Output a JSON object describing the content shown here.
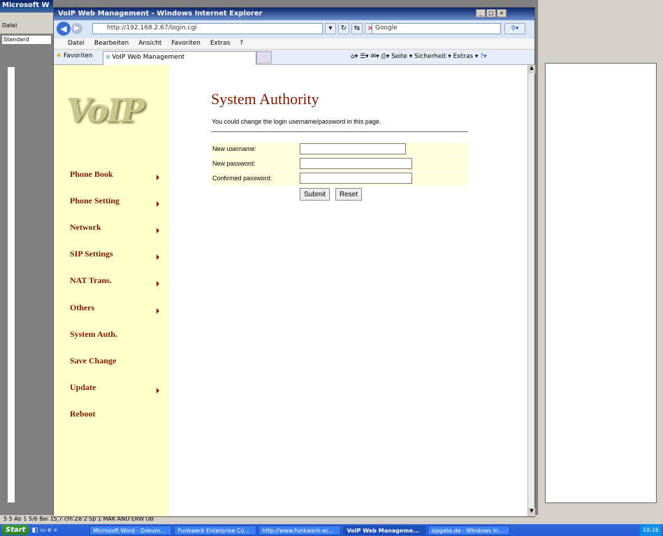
{
  "word": {
    "title": "Microsoft W",
    "style_value": "Standard",
    "menu_file": "Datei",
    "status": "5 5   Ab 1       5/6     Bei 15,7 cm  Ze 2    Sp 1      MAK  ÄND  ERW  ÜB"
  },
  "ie": {
    "title": "VoIP Web Management - Windows Internet Explorer",
    "url": "http://192.168.2.67/login.cgi",
    "search_placeholder": "Google",
    "menu": [
      "Datei",
      "Bearbeiten",
      "Ansicht",
      "Favoriten",
      "Extras",
      "?"
    ],
    "favorites_label": "Favoriten",
    "tab_label": "VoIP Web Management",
    "cmdbar": "Seite ▾   Sicherheit ▾   Extras ▾"
  },
  "page": {
    "logo": "VoIP",
    "nav": [
      {
        "label": "Phone Book",
        "arrow": true
      },
      {
        "label": "Phone Setting",
        "arrow": true
      },
      {
        "label": "Network",
        "arrow": true
      },
      {
        "label": "SIP Settings",
        "arrow": true
      },
      {
        "label": "NAT Trans.",
        "arrow": true
      },
      {
        "label": "Others",
        "arrow": true
      },
      {
        "label": "System Auth.",
        "arrow": false
      },
      {
        "label": "Save Change",
        "arrow": false
      },
      {
        "label": "Update",
        "arrow": true
      },
      {
        "label": "Reboot",
        "arrow": false
      }
    ],
    "title": "System Authority",
    "description": "You could change the login username/password in this page.",
    "fields": {
      "new_username": {
        "label": "New username:",
        "value": ""
      },
      "new_password": {
        "label": "New password:",
        "value": ""
      },
      "confirmed_password": {
        "label": "Confirmed password:",
        "value": ""
      }
    },
    "submit_label": "Submit",
    "reset_label": "Reset"
  },
  "taskbar": {
    "start": "Start",
    "items": [
      {
        "label": "Microsoft Word - Dokum...",
        "active": false
      },
      {
        "label": "Funkwerk Enterprise Co...",
        "active": false
      },
      {
        "label": "http://www.funkwerk-ec...",
        "active": false
      },
      {
        "label": "VoIP Web Manageme...",
        "active": true
      },
      {
        "label": "sipgate.de - Windows In...",
        "active": false
      }
    ],
    "clock": "10:16"
  }
}
